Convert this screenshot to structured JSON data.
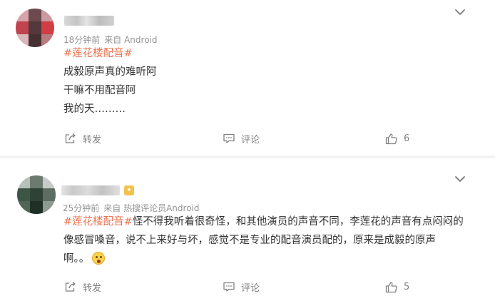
{
  "posts": [
    {
      "time": "18分钟前",
      "source": "来自 Android",
      "topic": "#莲花楼配音#",
      "lines": [
        "成毅原声真的难听阿",
        "干嘛不用配音阿",
        "我的天………"
      ],
      "actions": {
        "repost": "转发",
        "comment": "评论",
        "likes": "6"
      },
      "icons": [
        "chevron-down-icon",
        "share-icon",
        "comment-icon",
        "thumbs-up-icon"
      ]
    },
    {
      "time": "25分钟前",
      "source": "来自 热搜评论员Android",
      "topic": "#莲花楼配音#",
      "text_part1": "怪不得我听着很奇怪，和其他演员的声音不同，李莲花的声音有点闷闷的",
      "text_part2": "像感冒嗓音，说不上来好与坏，感觉不是专业的配音演员配的，原来是成毅的原声",
      "text_part3": "啊。。",
      "emoji": "surprised-emoji",
      "actions": {
        "repost": "转发",
        "comment": "评论",
        "likes": "5"
      },
      "icons": [
        "chevron-down-icon",
        "share-icon",
        "comment-icon",
        "thumbs-up-icon"
      ]
    }
  ],
  "colors": {
    "topic": "#eb7350",
    "meta": "#939393",
    "action": "#808080",
    "text": "#333333"
  }
}
